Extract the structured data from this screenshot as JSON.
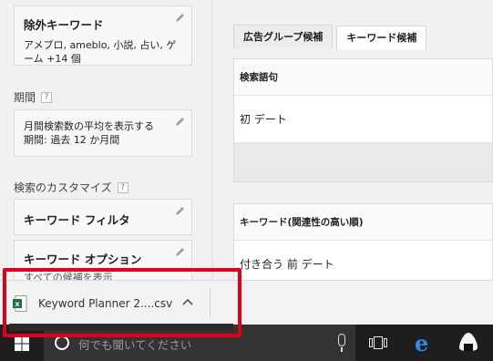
{
  "left": {
    "negative_keywords": {
      "title": "除外キーワード",
      "body": "アメブロ, ameblo, 小説, 占い, ゲーム +14 個"
    },
    "period": {
      "label": "期間",
      "help": "?",
      "body_line1": "月間検索数の平均を表示する",
      "body_line2": "期間: 過去 12 か月間"
    },
    "search_customize": {
      "label": "検索のカスタマイズ",
      "help": "?",
      "keyword_filter": "キーワード フィルタ",
      "keyword_options": "キーワード オプション",
      "options_sub": "すべての候補を表示"
    }
  },
  "right": {
    "tabs": [
      "広告グループ候補",
      "キーワード候補"
    ],
    "active_tab": 1,
    "table1": {
      "header": "検索語句",
      "row1": "初 デート"
    },
    "table2": {
      "header": "キーワード(関連性の高い順)",
      "row1": "付き合う 前 デート"
    }
  },
  "download_bar": {
    "file_name": "Keyword Planner 2....csv",
    "chevron": "^"
  },
  "taskbar": {
    "search_placeholder": "何でも聞いてください"
  },
  "colors": {
    "highlight": "#e0001b",
    "excel_green": "#1e7145",
    "edge_blue": "#2a8ee8",
    "taskbar": "#1e1e1e"
  }
}
